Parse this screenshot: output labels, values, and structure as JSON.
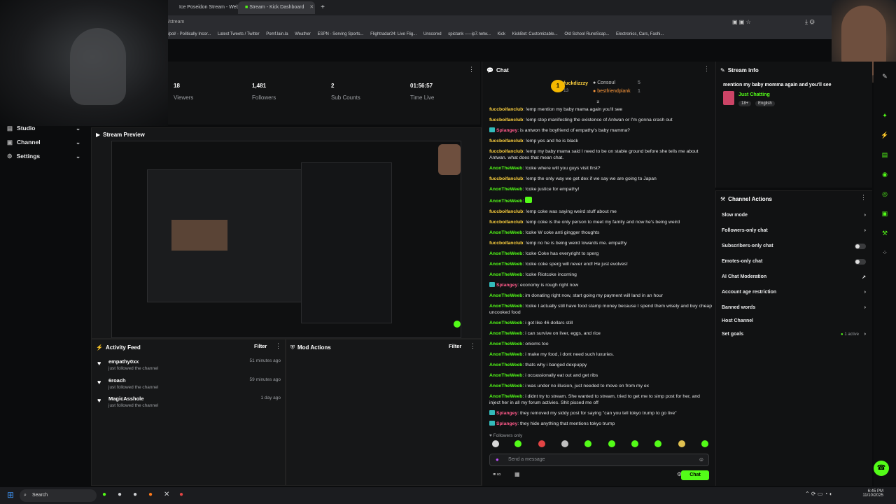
{
  "browser": {
    "tabs": [
      {
        "label": "Ice Poseidon Stream - Web"
      },
      {
        "label": "Stream - Kick Dashboard"
      }
    ],
    "url_fragment": "/stream",
    "bookmarks": [
      "/pol/ - Politically Incor...",
      "Latest Tweets / Twitter",
      "Pomf.lain.la",
      "Weather",
      "ESPN - Serving Sports...",
      "Flightradar24: Live Flig...",
      "Unscored",
      "spictank -----ip7.netw...",
      "Kick",
      "KickBot: Customizable...",
      "Old School RuneScap...",
      "Electronics, Cars, Fashi..."
    ]
  },
  "stats": [
    {
      "value": "18",
      "label": "Viewers"
    },
    {
      "value": "1,481",
      "label": "Followers"
    },
    {
      "value": "2",
      "label": "Sub Counts"
    },
    {
      "value": "01:56:57",
      "label": "Time Live"
    }
  ],
  "sidebar": {
    "items": [
      {
        "label": "Studio"
      },
      {
        "label": "Channel"
      },
      {
        "label": "Settings"
      }
    ]
  },
  "preview": {
    "title": "Stream Preview"
  },
  "activity": {
    "title": "Activity Feed",
    "filter": "Filter",
    "items": [
      {
        "name": "empathy0xx",
        "sub": "just followed the channel",
        "time": "51 minutes ago"
      },
      {
        "name": "6roach",
        "sub": "just followed the channel",
        "time": "59 minutes ago"
      },
      {
        "name": "MagicAsshole",
        "sub": "just followed the channel",
        "time": "1 day ago"
      }
    ]
  },
  "mod": {
    "title": "Mod Actions",
    "filter": "Filter"
  },
  "chat": {
    "title": "Chat",
    "top_users": [
      {
        "name": "fuckdizzzy",
        "count": "13"
      },
      {
        "name": "Consoul",
        "count": "5"
      },
      {
        "name": "bestfriendplank",
        "count": "1"
      }
    ],
    "messages": [
      {
        "user": "fuccboifanclub",
        "color": "#ffd23f",
        "text": "!emp mention my baby mama again you'll see"
      },
      {
        "user": "fuccboifanclub",
        "color": "#ffd23f",
        "text": "!emp stop manifesting the existence of Antwan or I'm gonna crash out"
      },
      {
        "user": "Splangey",
        "color": "#ff5a8a",
        "badge": true,
        "text": "is antwon the boyfriend of empathy's baby mamma?"
      },
      {
        "user": "fuccboifanclub",
        "color": "#ffd23f",
        "text": "!emp yes and he is black"
      },
      {
        "user": "fuccboifanclub",
        "color": "#ffd23f",
        "text": "!emp my baby mama said I need to be on stable ground before she tells me about Antwan. what does that mean chat."
      },
      {
        "user": "AnonTheWeeb",
        "color": "#53fc18",
        "text": "!coke where will you guys visit first?"
      },
      {
        "user": "fuccboifanclub",
        "color": "#ffd23f",
        "text": "!emp the only way we get dex if we say we are going to Japan"
      },
      {
        "user": "AnonTheWeeb",
        "color": "#53fc18",
        "text": "!coke justice for empathy!"
      },
      {
        "user": "AnonTheWeeb",
        "color": "#53fc18",
        "text": ""
      },
      {
        "user": "fuccboifanclub",
        "color": "#ffd23f",
        "text": "!emp coke was saying weird stuff about me"
      },
      {
        "user": "fuccboifanclub",
        "color": "#ffd23f",
        "text": "!emp coke is the only person to meet my family and now he's being weird"
      },
      {
        "user": "AnonTheWeeb",
        "color": "#53fc18",
        "text": "!coke W coke anti gingger thoughts"
      },
      {
        "user": "fuccboifanclub",
        "color": "#ffd23f",
        "text": "!emp no he is being weird towards me. empathy"
      },
      {
        "user": "AnonTheWeeb",
        "color": "#53fc18",
        "text": "!coke Coke has everyright to sperg"
      },
      {
        "user": "AnonTheWeeb",
        "color": "#53fc18",
        "text": "!coke coke sperg will never end! He just evolves!"
      },
      {
        "user": "AnonTheWeeb",
        "color": "#53fc18",
        "text": "!coke Riotcoke incoming"
      },
      {
        "user": "Splangey",
        "color": "#ff5a8a",
        "badge": true,
        "text": "economy is rough right now"
      },
      {
        "user": "AnonTheWeeb",
        "color": "#53fc18",
        "text": "im donating right now, start going my payment will land in an hour"
      },
      {
        "user": "AnonTheWeeb",
        "color": "#53fc18",
        "text": "!coke I actually still have food stamp money because I spend them wisely and buy cheap uncooked food"
      },
      {
        "user": "AnonTheWeeb",
        "color": "#53fc18",
        "text": "i got like 46 dollars still"
      },
      {
        "user": "AnonTheWeeb",
        "color": "#53fc18",
        "text": "i can survive on liver, eggs, and rice"
      },
      {
        "user": "AnonTheWeeb",
        "color": "#53fc18",
        "text": "onioms too"
      },
      {
        "user": "AnonTheWeeb",
        "color": "#53fc18",
        "text": "i make my food, i dont need such luxuries."
      },
      {
        "user": "AnonTheWeeb",
        "color": "#53fc18",
        "text": "thats why i banged dexpuppy"
      },
      {
        "user": "AnonTheWeeb",
        "color": "#53fc18",
        "text": "i occassionally eat out and get ribs"
      },
      {
        "user": "AnonTheWeeb",
        "color": "#53fc18",
        "text": "i was under no illusion, just needed to move on from my ex"
      },
      {
        "user": "AnonTheWeeb",
        "color": "#53fc18",
        "text": "i didnt try to stream. She wanted to stream, tried to get me to simp post for her, and inject her in all my forum activies. Shit pissed me off"
      },
      {
        "user": "Splangey",
        "color": "#ff5a8a",
        "badge": true,
        "text": "they removed my siddy post for saying \"can you tell tokyo trump to go live\""
      },
      {
        "user": "Splangey",
        "color": "#ff5a8a",
        "badge": true,
        "text": "they hide anything that mentions tokyo trump"
      }
    ],
    "followers_only": "Followers only",
    "input_placeholder": "Send a message",
    "send_label": "Chat"
  },
  "stream_info": {
    "title": "Stream info",
    "stream_title": "mention my baby momma again and you'll see",
    "category": "Just Chatting",
    "tags": [
      "18+",
      "English"
    ]
  },
  "channel_actions": {
    "title": "Channel Actions",
    "items": [
      {
        "label": "Slow mode",
        "kind": "arrow"
      },
      {
        "label": "Followers-only chat",
        "kind": "arrow"
      },
      {
        "label": "Subscribers-only chat",
        "kind": "toggle"
      },
      {
        "label": "Emotes-only chat",
        "kind": "toggle"
      },
      {
        "label": "AI Chat Moderation",
        "kind": "external"
      },
      {
        "label": "Account age restriction",
        "kind": "arrow"
      },
      {
        "label": "Banned words",
        "kind": "arrow"
      },
      {
        "label": "Host Channel",
        "kind": "none"
      },
      {
        "label": "Set goals",
        "kind": "arrow",
        "status": "1 active"
      }
    ]
  },
  "taskbar": {
    "search": "Search",
    "time": "6:45 PM",
    "date": "11/10/2025"
  },
  "colors": {
    "accent": "#53fc18",
    "bg": "#0b0c0d",
    "panel": "#161718"
  }
}
